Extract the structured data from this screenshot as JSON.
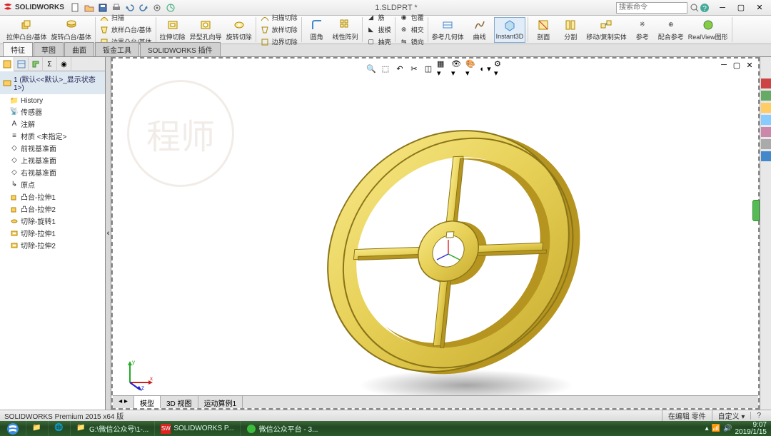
{
  "app": {
    "brand": "SOLIDWORKS",
    "doc_title": "1.SLDPRT *"
  },
  "search": {
    "placeholder": "搜索命令"
  },
  "ribbon": {
    "extrude": "拉伸凸台/基体",
    "revolve": "旋转凸台/基体",
    "sweep": "扫描",
    "loft": "放样凸台/基体",
    "boundary": "边界凸台/基体",
    "cut_extrude": "拉伸切除",
    "hole": "异型孔向导",
    "cut_revolve": "旋转切除",
    "cut_sweep": "扫描切除",
    "cut_loft": "放样切除",
    "cut_boundary": "边界切除",
    "fillet": "圆角",
    "pattern": "线性阵列",
    "rib": "筋",
    "draft": "拔模",
    "shell": "抽壳",
    "wrap": "包覆",
    "intersect": "相交",
    "mirror": "镜向",
    "ref_geom": "参考几何体",
    "curves": "曲线",
    "instant3d": "Instant3D",
    "section": "剖面",
    "split": "分割",
    "move_copy": "移动/复制实体",
    "ref": "参考",
    "config": "配合参考",
    "realview": "RealView图形"
  },
  "tabs": {
    "feature": "特征",
    "sketch": "草图",
    "surface": "曲面",
    "sheetmetal": "钣金工具",
    "plugins": "SOLIDWORKS 插件"
  },
  "tree": {
    "root": "1 (默认<<默认>_显示状态 1>)",
    "history": "History",
    "sensors": "传感器",
    "annotations": "注解",
    "material": "材质 <未指定>",
    "front_plane": "前视基准面",
    "top_plane": "上视基准面",
    "right_plane": "右视基准面",
    "origin": "原点",
    "f1": "凸台-拉伸1",
    "f2": "凸台-拉伸2",
    "f3": "切除-旋转1",
    "f4": "切除-拉伸1",
    "f5": "切除-拉伸2"
  },
  "model_tabs": {
    "model": "模型",
    "view3d": "3D 视图",
    "motion": "运动算例1"
  },
  "status": {
    "version": "SOLIDWORKS Premium 2015 x64 版",
    "editing": "在编辑  零件",
    "custom": "自定义"
  },
  "taskbar": {
    "explorer": "G:\\微信公众号\\1-...",
    "sw": "SOLIDWORKS P...",
    "wechat": "微信公众平台 - 3...",
    "time": "9:07",
    "date": "2019/1/15"
  }
}
